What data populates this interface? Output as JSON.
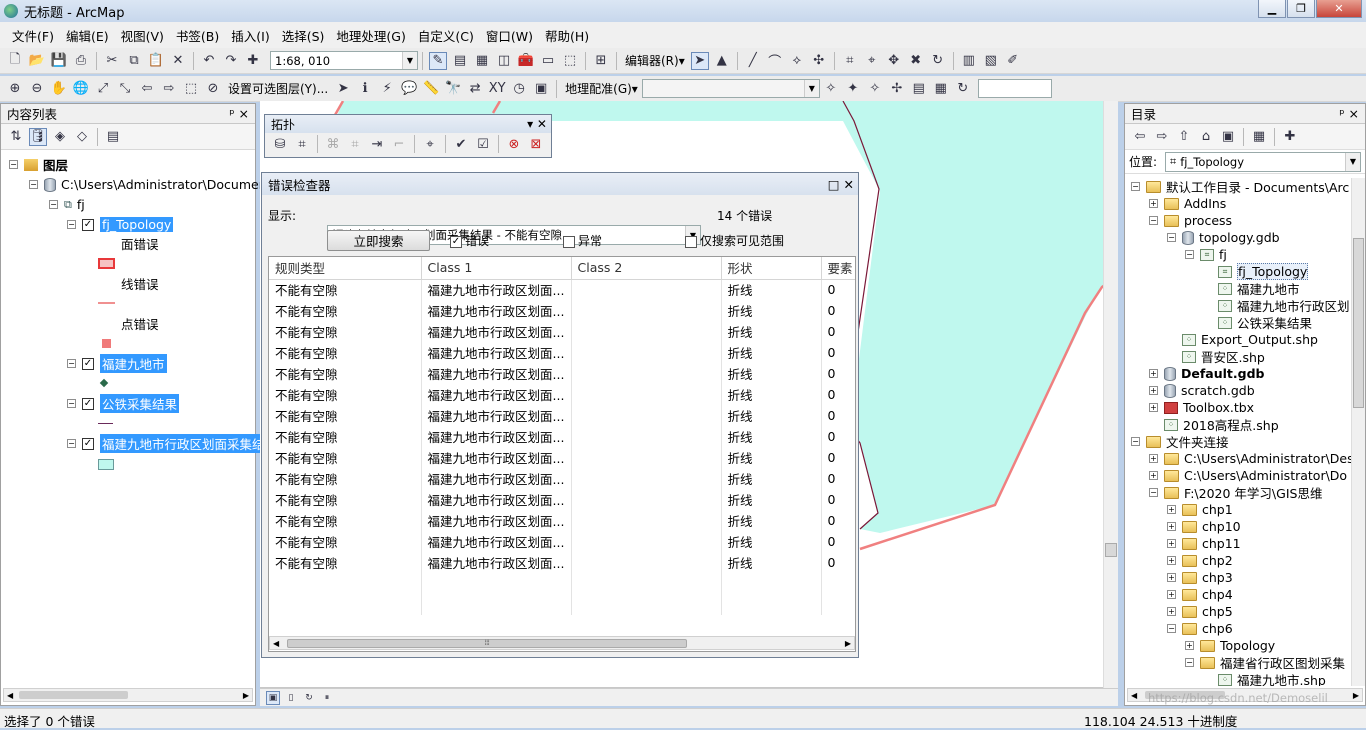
{
  "window": {
    "title": "无标题 - ArcMap"
  },
  "menu": [
    "文件(F)",
    "编辑(E)",
    "视图(V)",
    "书签(B)",
    "插入(I)",
    "选择(S)",
    "地理处理(G)",
    "自定义(C)",
    "窗口(W)",
    "帮助(H)"
  ],
  "toolbar1": {
    "scale": "1:68, 010",
    "editor_label": "编辑器(R)▾"
  },
  "toolbar2": {
    "selectable_layers": "设置可选图层(Y)...",
    "georef_label": "地理配准(G)▾"
  },
  "toc": {
    "title": "内容列表",
    "pin": "ᵖ ×",
    "layers_root": "图层",
    "path": "C:\\Users\\Administrator\\Documer",
    "dataset": "fj",
    "items": [
      {
        "label": "fj_Topology",
        "sublabels": [
          "面错误",
          "线错误",
          "点错误"
        ]
      },
      {
        "label": "福建九地市"
      },
      {
        "label": "公铁采集结果"
      },
      {
        "label": "福建九地市行政区划面采集结"
      }
    ]
  },
  "topology_toolbar": {
    "title": "拓扑"
  },
  "error_inspector": {
    "title": "错误检查器",
    "show_label": "显示:",
    "show_value": "福建九地市行政区划面采集结果 - 不能有空隙",
    "error_count": "14 个错误",
    "search_button": "立即搜索",
    "options": [
      {
        "label": "错误",
        "checked": true
      },
      {
        "label": "异常",
        "checked": false
      },
      {
        "label": "仅搜索可见范围",
        "checked": false
      }
    ],
    "columns": [
      "规则类型",
      "Class 1",
      "Class 2",
      "形状",
      "要素"
    ],
    "rows": [
      [
        "不能有空隙",
        "福建九地市行政区划面...",
        "",
        "折线",
        "0"
      ],
      [
        "不能有空隙",
        "福建九地市行政区划面...",
        "",
        "折线",
        "0"
      ],
      [
        "不能有空隙",
        "福建九地市行政区划面...",
        "",
        "折线",
        "0"
      ],
      [
        "不能有空隙",
        "福建九地市行政区划面...",
        "",
        "折线",
        "0"
      ],
      [
        "不能有空隙",
        "福建九地市行政区划面...",
        "",
        "折线",
        "0"
      ],
      [
        "不能有空隙",
        "福建九地市行政区划面...",
        "",
        "折线",
        "0"
      ],
      [
        "不能有空隙",
        "福建九地市行政区划面...",
        "",
        "折线",
        "0"
      ],
      [
        "不能有空隙",
        "福建九地市行政区划面...",
        "",
        "折线",
        "0"
      ],
      [
        "不能有空隙",
        "福建九地市行政区划面...",
        "",
        "折线",
        "0"
      ],
      [
        "不能有空隙",
        "福建九地市行政区划面...",
        "",
        "折线",
        "0"
      ],
      [
        "不能有空隙",
        "福建九地市行政区划面...",
        "",
        "折线",
        "0"
      ],
      [
        "不能有空隙",
        "福建九地市行政区划面...",
        "",
        "折线",
        "0"
      ],
      [
        "不能有空隙",
        "福建九地市行政区划面...",
        "",
        "折线",
        "0"
      ],
      [
        "不能有空隙",
        "福建九地市行政区划面...",
        "",
        "折线",
        "0"
      ]
    ]
  },
  "catalog": {
    "title": "目录",
    "location_label": "位置:",
    "location_value": "fj_Topology",
    "tree": [
      {
        "label": "默认工作目录 - Documents\\Arc",
        "level": 0,
        "type": "folder",
        "exp": "−"
      },
      {
        "label": "AddIns",
        "level": 1,
        "type": "folder",
        "exp": "+"
      },
      {
        "label": "process",
        "level": 1,
        "type": "folder",
        "exp": "−"
      },
      {
        "label": "topology.gdb",
        "level": 2,
        "type": "db",
        "exp": "−"
      },
      {
        "label": "fj",
        "level": 3,
        "type": "fds",
        "exp": "−"
      },
      {
        "label": "fj_Topology",
        "level": 4,
        "type": "topo",
        "exp": ""
      },
      {
        "label": "福建九地市",
        "level": 4,
        "type": "fc",
        "exp": ""
      },
      {
        "label": "福建九地市行政区划",
        "level": 4,
        "type": "fc",
        "exp": ""
      },
      {
        "label": "公铁采集结果",
        "level": 4,
        "type": "fc",
        "exp": ""
      },
      {
        "label": "Export_Output.shp",
        "level": 2,
        "type": "fc",
        "exp": ""
      },
      {
        "label": "晋安区.shp",
        "level": 2,
        "type": "fc",
        "exp": ""
      },
      {
        "label": "Default.gdb",
        "level": 1,
        "type": "db",
        "exp": "+",
        "bold": true
      },
      {
        "label": "scratch.gdb",
        "level": 1,
        "type": "db",
        "exp": "+"
      },
      {
        "label": "Toolbox.tbx",
        "level": 1,
        "type": "tbx",
        "exp": "+"
      },
      {
        "label": "2018高程点.shp",
        "level": 1,
        "type": "fc",
        "exp": ""
      },
      {
        "label": "文件夹连接",
        "level": 0,
        "type": "folder",
        "exp": "−"
      },
      {
        "label": "C:\\Users\\Administrator\\Des",
        "level": 1,
        "type": "folder",
        "exp": "+"
      },
      {
        "label": "C:\\Users\\Administrator\\Do",
        "level": 1,
        "type": "folder",
        "exp": "+"
      },
      {
        "label": "F:\\2020 年学习\\GIS思维",
        "level": 1,
        "type": "folder",
        "exp": "−"
      },
      {
        "label": "chp1",
        "level": 2,
        "type": "folder",
        "exp": "+"
      },
      {
        "label": "chp10",
        "level": 2,
        "type": "folder",
        "exp": "+"
      },
      {
        "label": "chp11",
        "level": 2,
        "type": "folder",
        "exp": "+"
      },
      {
        "label": "chp2",
        "level": 2,
        "type": "folder",
        "exp": "+"
      },
      {
        "label": "chp3",
        "level": 2,
        "type": "folder",
        "exp": "+"
      },
      {
        "label": "chp4",
        "level": 2,
        "type": "folder",
        "exp": "+"
      },
      {
        "label": "chp5",
        "level": 2,
        "type": "folder",
        "exp": "+"
      },
      {
        "label": "chp6",
        "level": 2,
        "type": "folder",
        "exp": "−"
      },
      {
        "label": "Topology",
        "level": 3,
        "type": "folder",
        "exp": "+"
      },
      {
        "label": "福建省行政区图划采集",
        "level": 3,
        "type": "folder",
        "exp": "−"
      },
      {
        "label": "福建九地市.shp",
        "level": 4,
        "type": "fc",
        "exp": ""
      }
    ]
  },
  "status": {
    "left": "选择了 0 个错误",
    "coords": "118.104  24.513 十进制度",
    "watermark": "https://blog.csdn.net/Demoselil"
  },
  "colors": {
    "map_fill": "#bff8ee",
    "boundary": "#f08080",
    "selection": "#3399ff"
  }
}
